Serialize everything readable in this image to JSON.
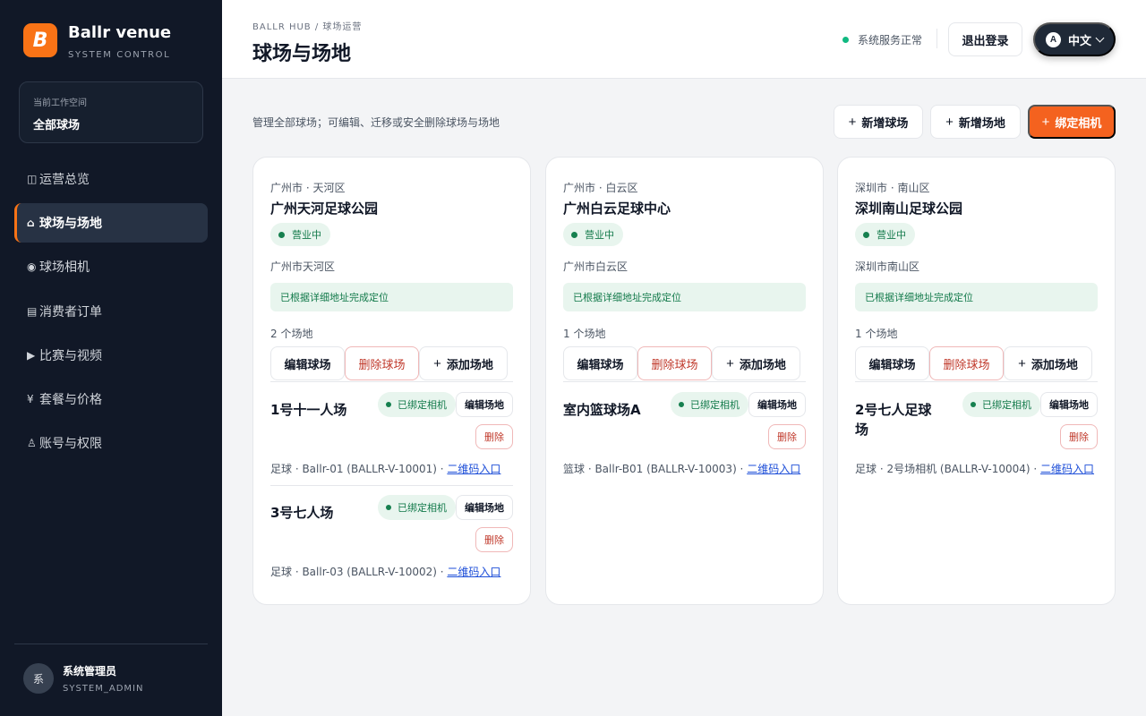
{
  "brand": {
    "logo_letter": "B",
    "name": "Ballr venue",
    "subtitle": "SYSTEM CONTROL",
    "accent": "#f97316"
  },
  "workspace": {
    "label": "当前工作空间",
    "value": "全部球场"
  },
  "nav": [
    {
      "icon": "◫",
      "icon_name": "dashboard-icon",
      "label": "运营总览",
      "active": false
    },
    {
      "icon": "⌂",
      "icon_name": "home-icon",
      "label": "球场与场地",
      "active": true
    },
    {
      "icon": "◉",
      "icon_name": "camera-icon",
      "label": "球场相机",
      "active": false
    },
    {
      "icon": "▤",
      "icon_name": "orders-icon",
      "label": "消费者订单",
      "active": false
    },
    {
      "icon": "▶",
      "icon_name": "play-icon",
      "label": "比赛与视频",
      "active": false
    },
    {
      "icon": "¥",
      "icon_name": "yen-icon",
      "label": "套餐与价格",
      "active": false
    },
    {
      "icon": "♙",
      "icon_name": "user-icon",
      "label": "账号与权限",
      "active": false
    }
  ],
  "user": {
    "avatar": "系",
    "name": "系统管理员",
    "role": "SYSTEM_ADMIN"
  },
  "header": {
    "breadcrumb": "BALLR HUB / 球场运营",
    "title": "球场与场地",
    "status_text": "系统服务正常",
    "status_color": "#10b981",
    "logout_label": "退出登录",
    "lang_icon": "A",
    "lang_label": "中文"
  },
  "toolbar": {
    "description": "管理全部球场；可编辑、迁移或安全删除球场与场地",
    "add_stadium": "新增球场",
    "add_field": "新增场地",
    "bind_camera": "绑定相机",
    "primary_color": "#f4621f"
  },
  "card_labels": {
    "open_status": "营业中",
    "located": "已根据详细地址完成定位",
    "edit_stadium": "编辑球场",
    "delete_stadium": "删除球场",
    "add_field": "添加场地",
    "camera_bound": "已绑定相机",
    "edit_field": "编辑场地",
    "delete": "删除",
    "qr_entry": "二维码入口"
  },
  "stadiums": [
    {
      "region": "广州市 · 天河区",
      "name": "广州天河足球公园",
      "address": "广州市天河区",
      "field_count": "2 个场地",
      "fields": [
        {
          "name": "1号十一人场",
          "meta": "足球 · Ballr-01 (BALLR-V-10001) · "
        },
        {
          "name": "3号七人场",
          "meta": "足球 · Ballr-03 (BALLR-V-10002) · "
        }
      ]
    },
    {
      "region": "广州市 · 白云区",
      "name": "广州白云足球中心",
      "address": "广州市白云区",
      "field_count": "1 个场地",
      "fields": [
        {
          "name": "室内篮球场A",
          "meta": "篮球 · Ballr-B01 (BALLR-V-10003) · "
        }
      ]
    },
    {
      "region": "深圳市 · 南山区",
      "name": "深圳南山足球公园",
      "address": "深圳市南山区",
      "field_count": "1 个场地",
      "fields": [
        {
          "name": "2号七人足球场",
          "meta": "足球 · 2号场相机 (BALLR-V-10004) · "
        }
      ]
    }
  ]
}
